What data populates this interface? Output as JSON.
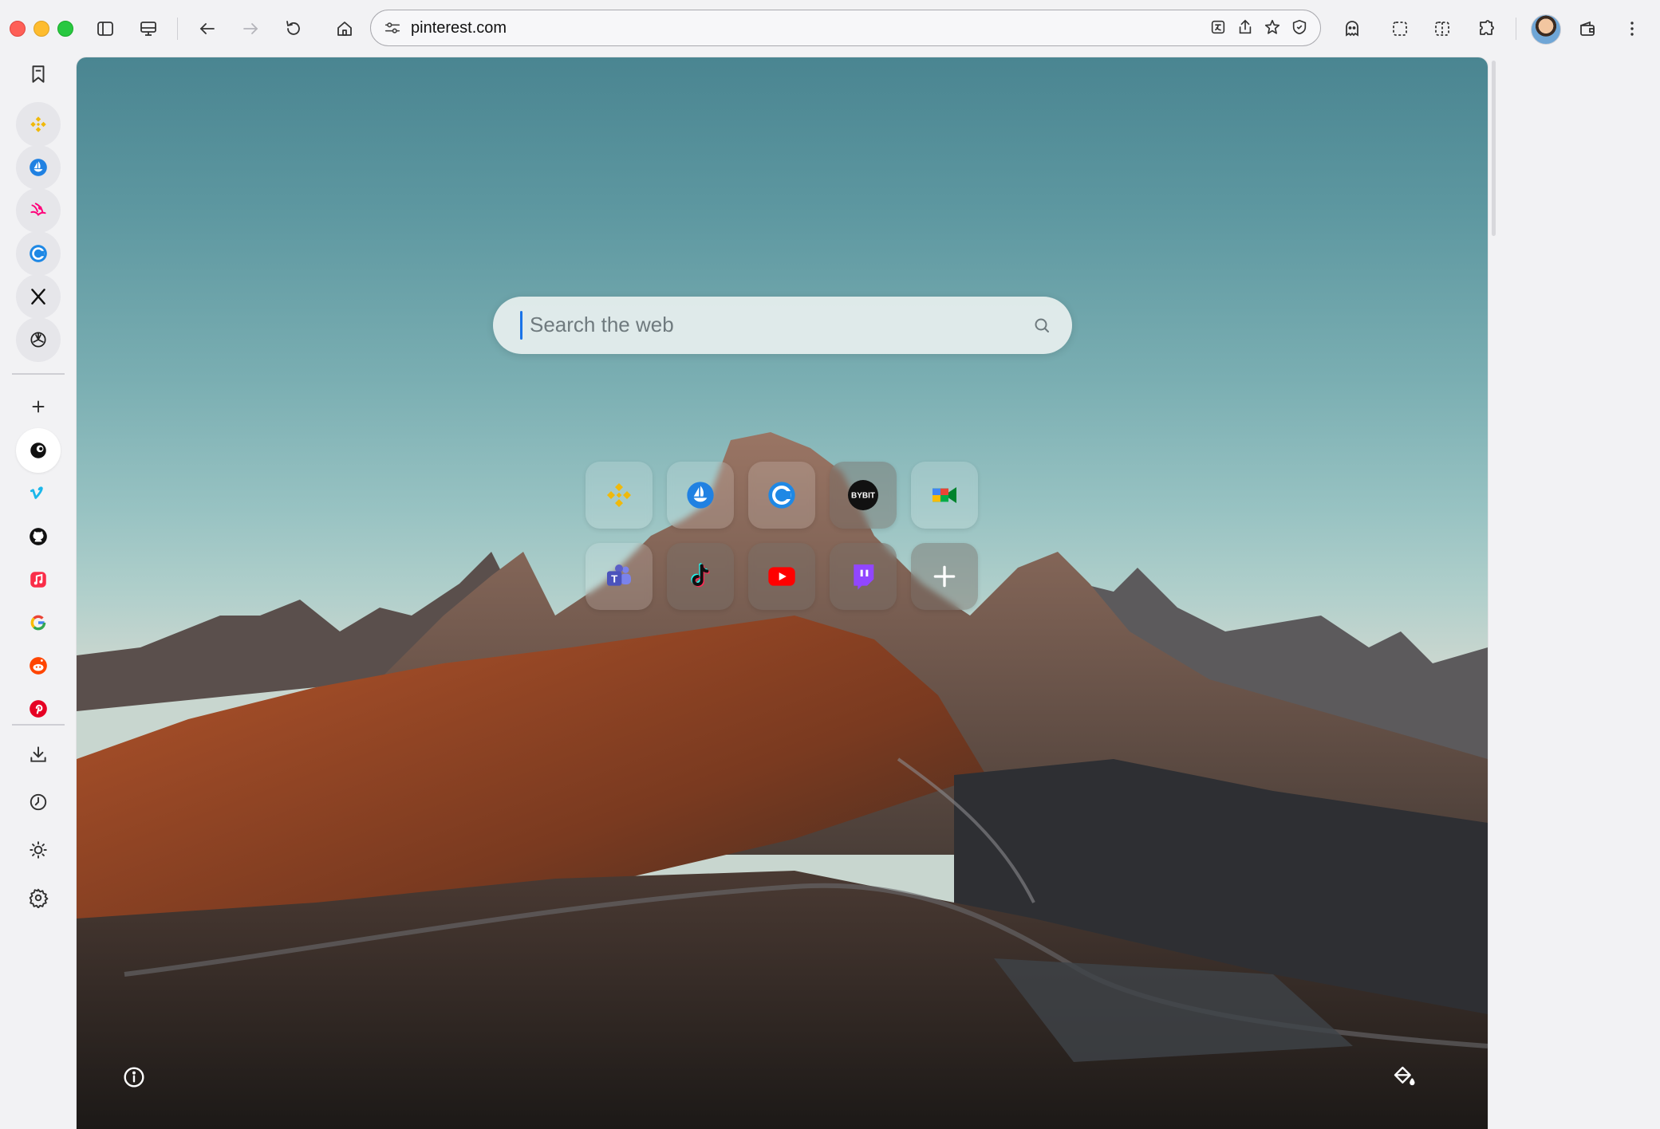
{
  "window": {
    "controls": [
      "close",
      "minimize",
      "zoom"
    ]
  },
  "toolbar": {
    "url": "pinterest.com",
    "buttons": [
      "sidebar-toggle",
      "workspaces",
      "back",
      "forward",
      "reload",
      "home"
    ],
    "url_actions": [
      "translate",
      "share",
      "bookmark-star",
      "shield"
    ],
    "right_buttons": [
      "assistant",
      "screenshot",
      "split-view",
      "extensions",
      "wallet",
      "menu"
    ]
  },
  "sidebar": {
    "items": [
      {
        "name": "bookmarks",
        "icon": "bookmark-icon"
      },
      {
        "name": "binance",
        "icon": "binance-icon",
        "color": "#f0b90b"
      },
      {
        "name": "opensea",
        "icon": "opensea-icon",
        "color": "#2081e2"
      },
      {
        "name": "uniswap",
        "icon": "uniswap-icon",
        "color": "#ff007a"
      },
      {
        "name": "coinmarketcap",
        "icon": "coinmarketcap-icon",
        "color": "#1e88e5"
      },
      {
        "name": "x",
        "icon": "x-icon",
        "color": "#111111"
      },
      {
        "name": "chatgpt",
        "icon": "chatgpt-icon",
        "color": "#222222"
      },
      {
        "name": "add",
        "icon": "plus-icon"
      },
      {
        "name": "sigma",
        "icon": "sigma-icon",
        "color": "#111111"
      },
      {
        "name": "vimeo",
        "icon": "vimeo-icon",
        "color": "#1ab7ea"
      },
      {
        "name": "github",
        "icon": "github-icon",
        "color": "#111111"
      },
      {
        "name": "apple-music",
        "icon": "music-icon",
        "color": "#fa2d48"
      },
      {
        "name": "google",
        "icon": "google-icon",
        "color": "#4285f4"
      },
      {
        "name": "reddit",
        "icon": "reddit-icon",
        "color": "#ff4500"
      },
      {
        "name": "pinterest",
        "icon": "pinterest-icon",
        "color": "#e60023"
      },
      {
        "name": "downloads",
        "icon": "download-icon"
      },
      {
        "name": "history",
        "icon": "clock-icon"
      },
      {
        "name": "theme",
        "icon": "sun-icon"
      },
      {
        "name": "settings",
        "icon": "gear-icon"
      }
    ]
  },
  "search": {
    "placeholder": "Search the web"
  },
  "speed_dial": [
    {
      "name": "binance",
      "icon": "binance-icon",
      "color": "#f0b90b"
    },
    {
      "name": "opensea",
      "icon": "opensea-icon",
      "color": "#2081e2"
    },
    {
      "name": "coinmarketcap",
      "icon": "coinmarketcap-icon",
      "color": "#1e88e5"
    },
    {
      "name": "bybit",
      "icon": "bybit-icon",
      "label": "BYBIT",
      "color": "#111111"
    },
    {
      "name": "google-meet",
      "icon": "meet-icon",
      "color": "#00832d"
    },
    {
      "name": "teams",
      "icon": "teams-icon",
      "color": "#5b5fc7"
    },
    {
      "name": "tiktok",
      "icon": "tiktok-icon",
      "color": "#111111"
    },
    {
      "name": "youtube",
      "icon": "youtube-icon",
      "color": "#ff0000"
    },
    {
      "name": "twitch",
      "icon": "twitch-icon",
      "color": "#9146ff"
    },
    {
      "name": "add-shortcut",
      "icon": "plus-icon",
      "color": "#ffffff"
    }
  ],
  "footer": {
    "left_icon": "info-icon",
    "right_icon": "paint-bucket-icon"
  }
}
